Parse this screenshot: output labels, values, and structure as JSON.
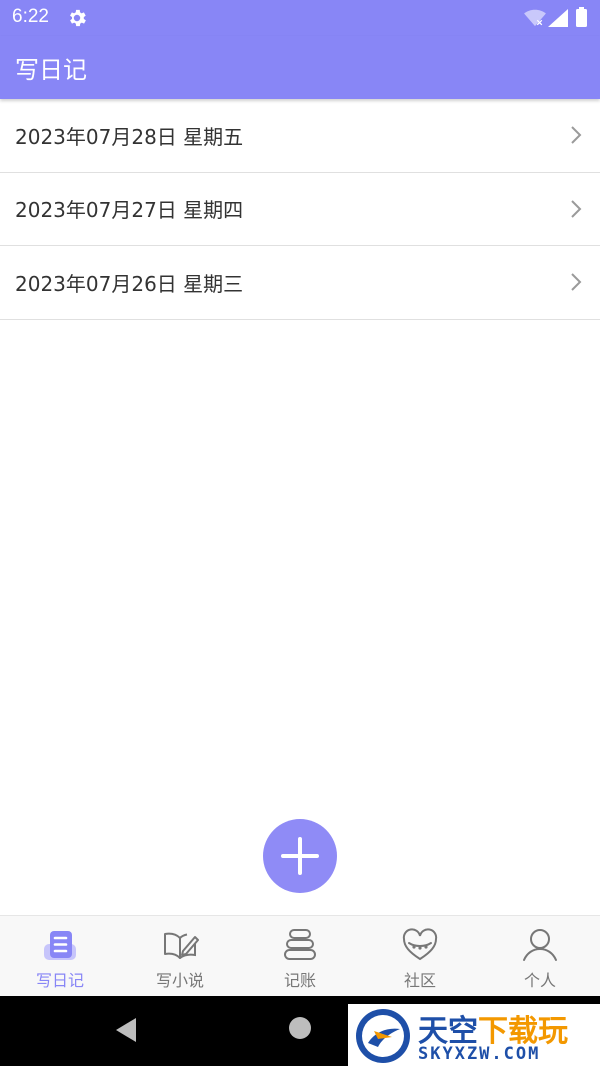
{
  "status_bar": {
    "time": "6:22"
  },
  "app_bar": {
    "title": "写日记"
  },
  "diary_entries": [
    {
      "label": "2023年07月28日 星期五"
    },
    {
      "label": "2023年07月27日 星期四"
    },
    {
      "label": "2023年07月26日 星期三"
    }
  ],
  "fab": {
    "icon": "plus-icon"
  },
  "bottom_nav": {
    "items": [
      {
        "label": "写日记",
        "icon": "diary-icon",
        "active": true
      },
      {
        "label": "写小说",
        "icon": "novel-icon",
        "active": false
      },
      {
        "label": "记账",
        "icon": "ledger-icon",
        "active": false
      },
      {
        "label": "社区",
        "icon": "community-icon",
        "active": false
      },
      {
        "label": "个人",
        "icon": "profile-icon",
        "active": false
      }
    ]
  },
  "watermark": {
    "title_main": "天空",
    "title_accent": "下载玩",
    "subtitle": "SKYXZW.COM"
  },
  "colors": {
    "primary": "#8886f6",
    "fab": "#8f8bf6",
    "inactive": "#777777"
  }
}
